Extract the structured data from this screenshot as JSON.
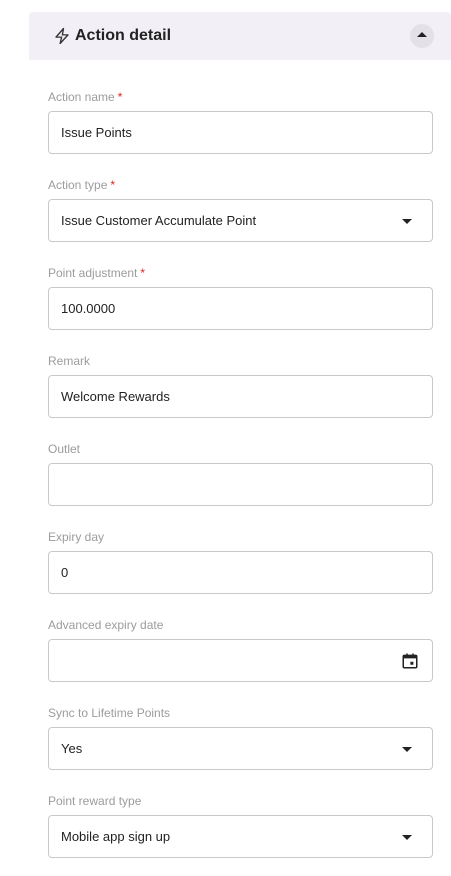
{
  "header": {
    "title": "Action detail",
    "icon": "lightning-bolt-icon",
    "collapse_icon": "chevron-up-icon"
  },
  "fields": {
    "action_name": {
      "label": "Action name",
      "required_mark": "*",
      "value": "Issue Points"
    },
    "action_type": {
      "label": "Action type",
      "required_mark": "*",
      "value": "Issue Customer Accumulate Point"
    },
    "point_adjustment": {
      "label": "Point adjustment",
      "required_mark": "*",
      "value": "100.0000"
    },
    "remark": {
      "label": "Remark",
      "value": "Welcome Rewards"
    },
    "outlet": {
      "label": "Outlet",
      "value": ""
    },
    "expiry_day": {
      "label": "Expiry day",
      "value": "0"
    },
    "advanced_expiry_date": {
      "label": "Advanced expiry date",
      "value": "",
      "icon": "calendar-icon"
    },
    "sync_lifetime": {
      "label": "Sync to Lifetime Points",
      "value": "Yes"
    },
    "point_reward_type": {
      "label": "Point reward type",
      "value": "Mobile app sign up"
    }
  },
  "colors": {
    "header_bg": "#f2f0f6",
    "required": "#e0241b",
    "label": "#9c9c9c",
    "border": "#c9c9c9"
  }
}
